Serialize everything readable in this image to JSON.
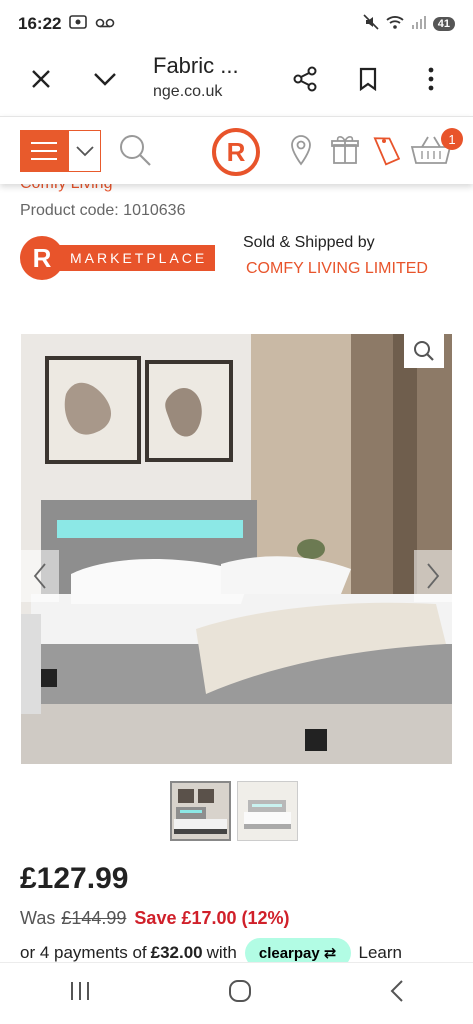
{
  "status": {
    "time": "16:22",
    "battery": "41"
  },
  "browser": {
    "title": "Fabric ...",
    "url": "nge.co.uk"
  },
  "site": {
    "logo_letter": "R",
    "basket_count": "1"
  },
  "product": {
    "brand": "Comfy Living",
    "code": "Product code: 1010636",
    "marketplace_letter": "R",
    "marketplace_label": "MARKETPLACE",
    "sold_by": "Sold & Shipped by",
    "seller": "COMFY LIVING LIMITED",
    "price": "£127.99",
    "was_label": "Was",
    "was_price": "£144.99",
    "save": "Save £17.00 (12%)",
    "payments_prefix": "or 4 payments of",
    "payments_amount": "£32.00",
    "payments_suffix": "with",
    "clearpay_label": "clearpay",
    "learn": "Learn"
  },
  "colors": {
    "brand": "#e8542b",
    "save": "#d0202a",
    "clearpay": "#b2fce4"
  }
}
